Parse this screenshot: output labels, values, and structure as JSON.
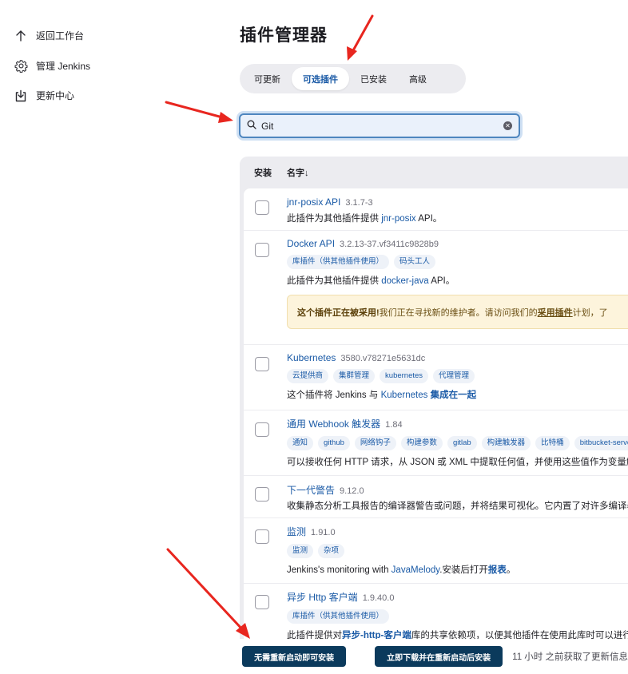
{
  "sidebar": {
    "items": [
      {
        "label": "返回工作台",
        "icon": "arrow-up-icon"
      },
      {
        "label": "管理 Jenkins",
        "icon": "gear-icon"
      },
      {
        "label": "更新中心",
        "icon": "download-icon"
      }
    ]
  },
  "page": {
    "title": "插件管理器"
  },
  "tabs": [
    {
      "label": "可更新",
      "active": false
    },
    {
      "label": "可选插件",
      "active": true
    },
    {
      "label": "已安装",
      "active": false
    },
    {
      "label": "高级",
      "active": false
    }
  ],
  "search": {
    "value": "Git",
    "placeholder": ""
  },
  "table": {
    "col_install": "安装",
    "col_name": "名字↓",
    "rows": [
      {
        "name": "jnr-posix API",
        "version": "3.1.7-3",
        "desc_pre": "此插件为其他插件提供 ",
        "desc_link": "jnr-posix",
        "desc_post": " API。"
      },
      {
        "name": "Docker API",
        "version": "3.2.13-37.vf3411c9828b9",
        "tags": [
          "库插件（供其他插件使用）",
          "码头工人"
        ],
        "desc_pre": "此插件为其他插件提供 ",
        "desc_link": "docker-java",
        "desc_post": " API。",
        "warning": {
          "strong": "这个插件正在被采用!",
          "text": " 我们正在寻找新的维护者。请访问我们的",
          "link": "采用插件",
          "post": "计划，了"
        }
      },
      {
        "name": "Kubernetes",
        "version": "3580.v78271e5631dc",
        "tags": [
          "云提供商",
          "集群管理",
          "kubernetes",
          "代理管理"
        ],
        "desc_pre": "这个插件将 Jenkins 与 ",
        "desc_link": "Kubernetes",
        "desc_link2": "集成在一起"
      },
      {
        "name": "通用 Webhook 触发器",
        "version": "1.84",
        "tags": [
          "通知",
          "github",
          "网络钩子",
          "构建参数",
          "gitlab",
          "构建触发器",
          "比特桶",
          "bitbucket-server"
        ],
        "desc_pre": "可以接收任何 HTTP 请求，从 JSON 或 XML 中提取任何值，并使用这些值作为变量触发"
      },
      {
        "name": "下一代警告",
        "version": "9.12.0",
        "desc_pre": "收集静态分析工具报告的编译器警告或问题，并将结果可视化。它内置了对许多编译器"
      },
      {
        "name": "监测",
        "version": "1.91.0",
        "tags": [
          "监测",
          "杂项"
        ],
        "desc_pre": "Jenkins's monitoring with ",
        "desc_link": "JavaMelody",
        "desc_post": ".安装后打开",
        "desc_link2": "报表",
        "desc_post2": "。"
      },
      {
        "name": "异步 Http 客户端",
        "version": "1.9.40.0",
        "tags": [
          "库插件（供其他插件使用）"
        ],
        "desc_pre": "此插件提供对",
        "desc_link": "异步-http-客户端",
        "desc_post": "库的共享依赖项，以便其他插件在使用此库时可以进行"
      }
    ]
  },
  "bottom": {
    "btn_install_no_restart": "无需重新启动即可安装",
    "btn_download_restart": "立即下载并在重新启动后安装",
    "update_info": "11 小时 之前获取了更新信息"
  },
  "colors": {
    "accent": "#1a5aa6",
    "button": "#0b3a5c",
    "arrow": "#e8261f"
  }
}
